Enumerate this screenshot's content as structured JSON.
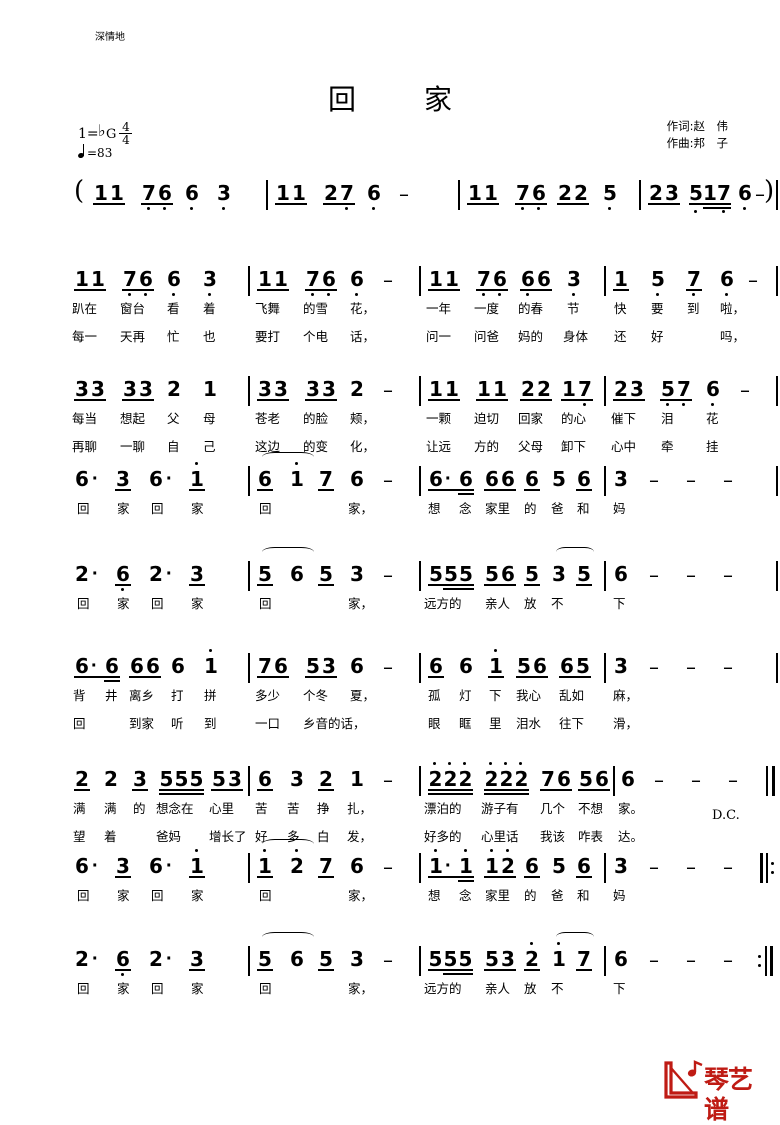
{
  "header": {
    "title": "回　家",
    "lyricist": "作词:赵　伟",
    "composer": "作曲:邦　子",
    "key_prefix": "1=",
    "key_flat": "♭",
    "key_letter": "G",
    "meter_top": "4",
    "meter_bottom": "4",
    "tempo": "=83",
    "expression": "深情地"
  },
  "rows": [
    {
      "name": "intro-row",
      "measures": [
        {
          "notes": [
            "1",
            "1",
            "7",
            "6",
            "6",
            "3"
          ]
        },
        {
          "notes": [
            "1",
            "1",
            "2",
            "7",
            "6",
            "–"
          ]
        },
        {
          "notes": [
            "1",
            "1",
            "7",
            "6",
            "2",
            "2",
            "5"
          ]
        },
        {
          "notes": [
            "2",
            "3",
            "5",
            "1",
            "7",
            "6",
            "–"
          ]
        }
      ],
      "open_paren": "(",
      "close_paren": ")"
    },
    {
      "name": "verse-row-1",
      "measures": [
        {
          "notes": [
            "1",
            "1",
            "7",
            "6",
            "6",
            "3"
          ]
        },
        {
          "notes": [
            "1",
            "1",
            "7",
            "6",
            "6",
            "–"
          ]
        },
        {
          "notes": [
            "1",
            "1",
            "7",
            "6",
            "6",
            "6",
            "3"
          ]
        },
        {
          "notes": [
            "1",
            "5",
            "7",
            "6",
            "–"
          ]
        }
      ],
      "lyrics_1": [
        "趴在",
        "窗台",
        "看",
        "着",
        "飞舞",
        "的雪",
        "花，",
        "一年",
        "一度",
        "的春",
        "节",
        "快",
        "要",
        "到",
        "啦，"
      ],
      "lyrics_2": [
        "每一",
        "天再",
        "忙",
        "也",
        "要打",
        "个电",
        "话，",
        "问一",
        "问爸",
        "妈的",
        "身体",
        "还",
        "好",
        "吗，"
      ]
    },
    {
      "name": "verse-row-2",
      "measures": [
        {
          "notes": [
            "3",
            "3",
            "3",
            "3",
            "2",
            "1"
          ]
        },
        {
          "notes": [
            "3",
            "3",
            "3",
            "3",
            "2",
            "–"
          ]
        },
        {
          "notes": [
            "1",
            "1",
            "1",
            "1",
            "2",
            "2",
            "1",
            "7"
          ]
        },
        {
          "notes": [
            "2",
            "3",
            "5",
            "7",
            "6",
            "–"
          ]
        }
      ],
      "lyrics_1": [
        "每当",
        "想起",
        "父",
        "母",
        "苍老",
        "的脸",
        "颊，",
        "一颗",
        "迫切",
        "回家",
        "的心",
        "催下",
        "泪",
        "花"
      ],
      "lyrics_2": [
        "再聊",
        "一聊",
        "自",
        "己",
        "这边",
        "的变",
        "化，",
        "让远",
        "方的",
        "父母",
        "卸下",
        "心中",
        "牵",
        "挂"
      ]
    },
    {
      "name": "chorus-row-1",
      "measures": [
        {
          "notes": [
            "6",
            "·",
            "3",
            "6",
            "·",
            "1"
          ]
        },
        {
          "notes": [
            "6",
            "1",
            "7",
            "6",
            "–"
          ]
        },
        {
          "notes": [
            "6",
            "·",
            "6",
            "6",
            "6",
            "6",
            "5",
            "6"
          ]
        },
        {
          "notes": [
            "3",
            "–",
            "–",
            "–"
          ]
        }
      ],
      "lyrics_1": [
        "回",
        "家",
        "回",
        "家",
        "回",
        "家，",
        "想",
        "念",
        "家里",
        "的",
        "爸",
        "和",
        "妈"
      ]
    },
    {
      "name": "chorus-row-2",
      "measures": [
        {
          "notes": [
            "2",
            "·",
            "6",
            "2",
            "·",
            "3"
          ]
        },
        {
          "notes": [
            "5",
            "6",
            "5",
            "3",
            "–"
          ]
        },
        {
          "notes": [
            "5",
            "5",
            "5",
            "5",
            "6",
            "5",
            "3",
            "5"
          ]
        },
        {
          "notes": [
            "6",
            "–",
            "–",
            "–"
          ]
        }
      ],
      "lyrics_1": [
        "回",
        "家",
        "回",
        "家",
        "回",
        "家，",
        "远方的",
        "亲人",
        "放",
        "不",
        "下"
      ]
    },
    {
      "name": "verse-row-3",
      "measures": [
        {
          "notes": [
            "6",
            "·",
            "6",
            "6",
            "6",
            "6",
            "1"
          ]
        },
        {
          "notes": [
            "7",
            "6",
            "5",
            "3",
            "6",
            "–"
          ]
        },
        {
          "notes": [
            "6",
            "6",
            "1",
            "5",
            "6",
            "6",
            "5"
          ]
        },
        {
          "notes": [
            "3",
            "–",
            "–",
            "–"
          ]
        }
      ],
      "lyrics_1": [
        "背",
        "井",
        "离乡",
        "打",
        "拼",
        "多少",
        "个冬",
        "夏，",
        "孤",
        "灯",
        "下",
        "我心",
        "乱如",
        "麻，"
      ],
      "lyrics_2": [
        "回",
        "到家",
        "听",
        "到",
        "一口",
        "乡音的话，",
        "眼",
        "眶",
        "里",
        "泪水",
        "往下",
        "滑，"
      ]
    },
    {
      "name": "verse-row-4",
      "measures": [
        {
          "notes": [
            "2",
            "2",
            "3",
            "5",
            "5",
            "5",
            "5",
            "3"
          ]
        },
        {
          "notes": [
            "6",
            "3",
            "2",
            "1",
            "–"
          ]
        },
        {
          "notes": [
            "2",
            "2",
            "2",
            "2",
            "2",
            "2",
            "7",
            "6",
            "5",
            "6"
          ]
        },
        {
          "notes": [
            "6",
            "–",
            "–",
            "–"
          ]
        }
      ],
      "lyrics_1": [
        "满",
        "满",
        "的",
        "想念在",
        "心里",
        "苦",
        "苦",
        "挣",
        "扎，",
        "漂泊的",
        "游子有",
        "几个",
        "不想",
        "家。"
      ],
      "lyrics_2": [
        "望",
        "着",
        "爸妈",
        "增长了",
        "好",
        "多",
        "白",
        "发，",
        "好多的",
        "心里话",
        "我该",
        "咋表",
        "达。"
      ],
      "dc_mark": "D.C."
    },
    {
      "name": "chorus-row-3",
      "measures": [
        {
          "notes": [
            "6",
            "·",
            "3",
            "6",
            "·",
            "1"
          ]
        },
        {
          "notes": [
            "1",
            "2",
            "7",
            "6",
            "–"
          ]
        },
        {
          "notes": [
            "1",
            "·",
            "1",
            "1",
            "2",
            "6",
            "5",
            "6"
          ]
        },
        {
          "notes": [
            "3",
            "–",
            "–",
            "–"
          ]
        }
      ],
      "lyrics_1": [
        "回",
        "家",
        "回",
        "家",
        "回",
        "家，",
        "想",
        "念",
        "家里",
        "的",
        "爸",
        "和",
        "妈"
      ]
    },
    {
      "name": "chorus-row-4",
      "measures": [
        {
          "notes": [
            "2",
            "·",
            "6",
            "2",
            "·",
            "3"
          ]
        },
        {
          "notes": [
            "5",
            "6",
            "5",
            "3",
            "–"
          ]
        },
        {
          "notes": [
            "5",
            "5",
            "5",
            "5",
            "3",
            "2",
            "1",
            "7"
          ]
        },
        {
          "notes": [
            "6",
            "–",
            "–",
            "–"
          ]
        }
      ],
      "lyrics_1": [
        "回",
        "家",
        "回",
        "家",
        "回",
        "家，",
        "远方的",
        "亲人",
        "放",
        "不",
        "下"
      ]
    }
  ],
  "watermark": {
    "text": "琴艺谱",
    "color": "#bf1b14"
  }
}
